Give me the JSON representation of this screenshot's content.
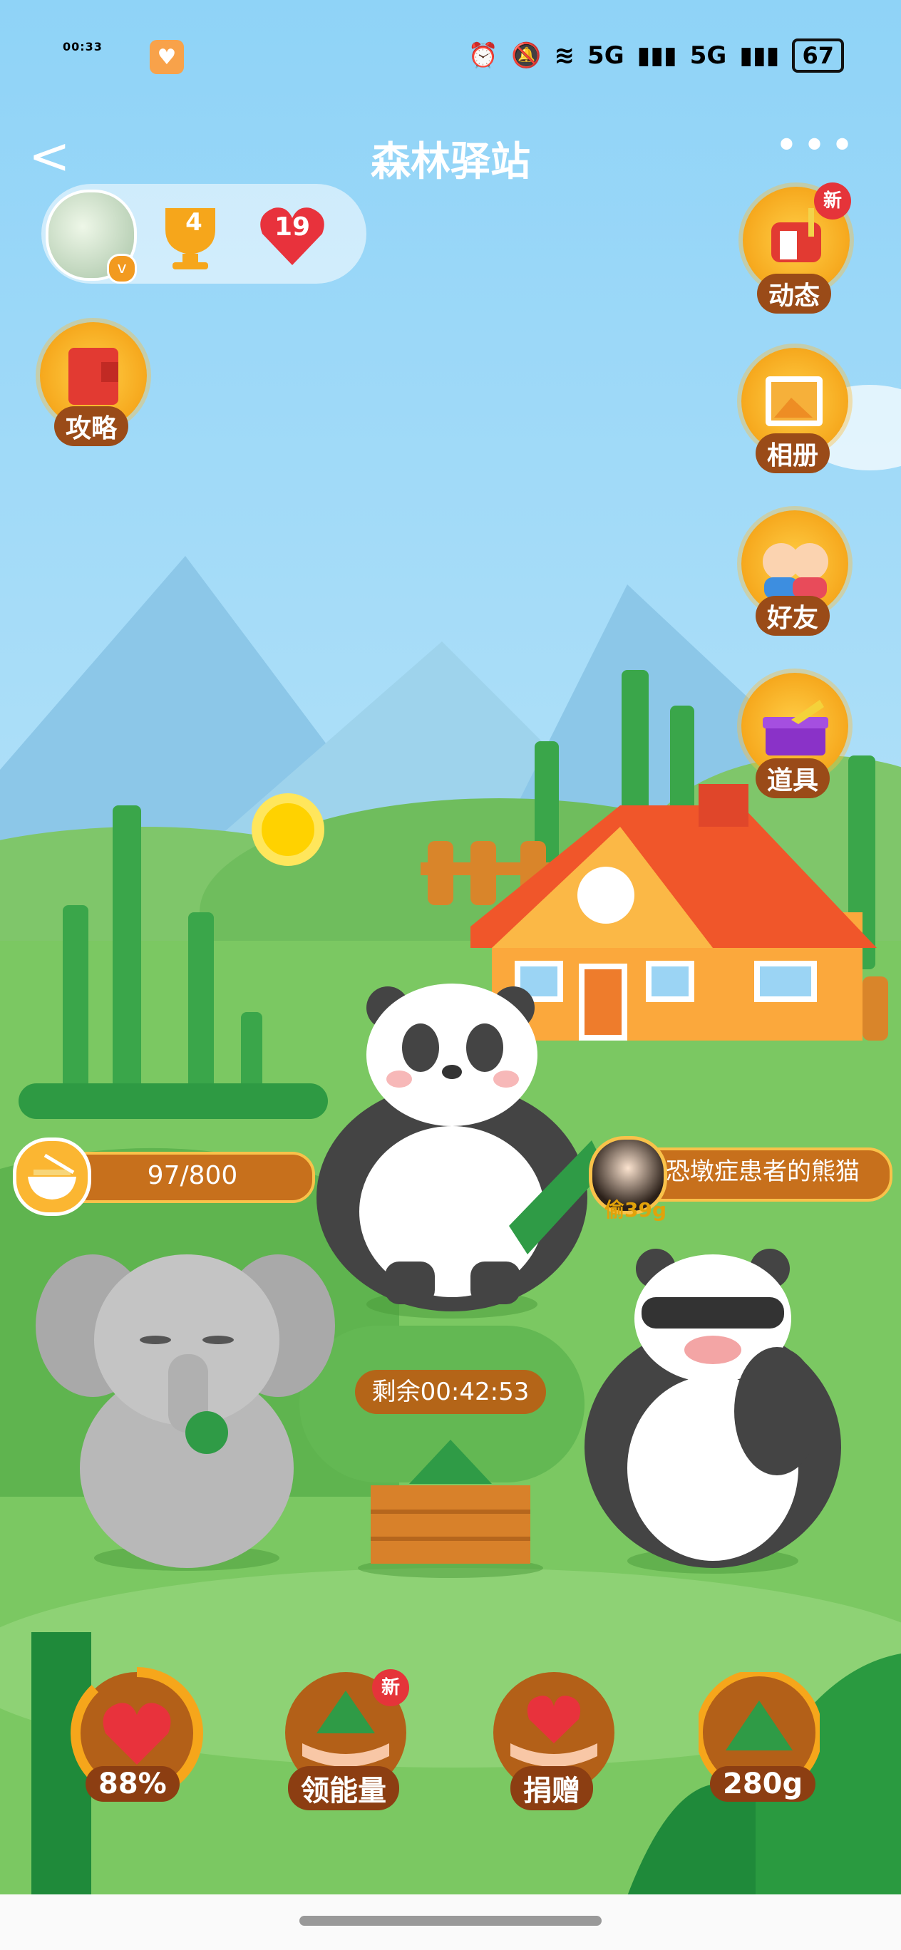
{
  "status_bar": {
    "time": "00:33",
    "signal1": "5G",
    "signal2": "5G",
    "battery": "67"
  },
  "header": {
    "title": "森林驿站",
    "back_label": "<",
    "more_label": "•••"
  },
  "profile": {
    "trophy_count": "4",
    "hearts_count": "19",
    "vip_badge": "v"
  },
  "side_buttons": {
    "dynamics": {
      "label": "动态",
      "badge": "新"
    },
    "guide": {
      "label": "攻略"
    },
    "album": {
      "label": "相册"
    },
    "friends": {
      "label": "好友"
    },
    "props": {
      "label": "道具"
    }
  },
  "food_progress": {
    "text": "97/800",
    "fraction": 0.121
  },
  "visitor": {
    "name": "恐墩症患者的熊猫",
    "steal_text": "偷39g"
  },
  "timer": {
    "text": "剩余00:42:53"
  },
  "bottom_buttons": {
    "health": {
      "label": "88%",
      "fraction": 0.88
    },
    "energy": {
      "label": "领能量",
      "badge": "新"
    },
    "donate": {
      "label": "捐赠"
    },
    "zongzi": {
      "label": "280g"
    }
  }
}
